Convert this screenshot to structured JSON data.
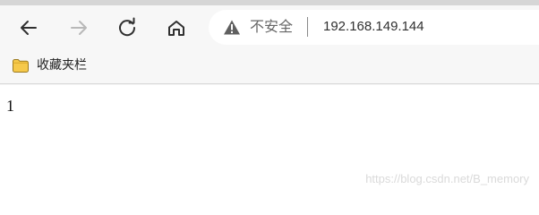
{
  "toolbar": {
    "security_label": "不安全",
    "url": "192.168.149.144"
  },
  "bookmarks": {
    "folder_label": "收藏夹栏"
  },
  "page": {
    "content": "1",
    "watermark": "https://blog.csdn.net/B_memory"
  },
  "icons": {
    "back": "back-arrow-icon",
    "forward": "forward-arrow-icon",
    "refresh": "refresh-icon",
    "home": "home-icon",
    "warning": "warning-icon",
    "folder": "folder-icon"
  },
  "colors": {
    "browser_chrome": "#f7f7f7",
    "address_bar": "#ffffff",
    "warning": "#606060",
    "folder": "#f6c94a"
  }
}
